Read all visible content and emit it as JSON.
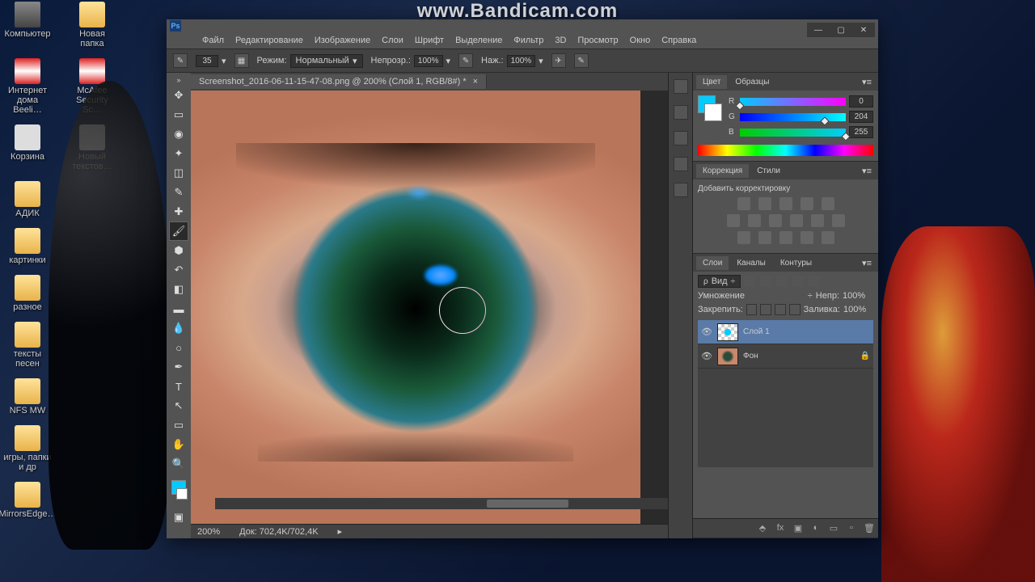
{
  "watermark": "www.Bandicam.com",
  "desktop": {
    "icons": [
      {
        "label": "Компьютер",
        "cls": "computer"
      },
      {
        "label": "Новая папка",
        "cls": "folder"
      },
      {
        "label": "Интернет дома Beeli…",
        "cls": "shield"
      },
      {
        "label": "McAfee Security Sc…",
        "cls": "shield"
      },
      {
        "label": "Корзина",
        "cls": "bin"
      },
      {
        "label": "Новый текстов…",
        "cls": "doc"
      },
      {
        "label": "АДИК",
        "cls": "folder"
      },
      {
        "label": "картинки",
        "cls": "folder"
      },
      {
        "label": "разное",
        "cls": "folder"
      },
      {
        "label": "тексты песен",
        "cls": "folder"
      },
      {
        "label": "NFS MW",
        "cls": "folder"
      },
      {
        "label": "игры, папки и др",
        "cls": "folder"
      },
      {
        "label": "MirrorsEdge…",
        "cls": "folder"
      }
    ]
  },
  "menu": [
    "Файл",
    "Редактирование",
    "Изображение",
    "Слои",
    "Шрифт",
    "Выделение",
    "Фильтр",
    "3D",
    "Просмотр",
    "Окно",
    "Справка"
  ],
  "options": {
    "brush_size": "35",
    "mode_label": "Режим:",
    "mode_value": "Нормальный",
    "opacity_label": "Непрозр.:",
    "opacity_value": "100%",
    "flow_label": "Наж.:",
    "flow_value": "100%"
  },
  "doc_tab": "Screenshot_2016-06-11-15-47-08.png @ 200% (Слой 1, RGB/8#) *",
  "status": {
    "zoom": "200%",
    "doc": "Док: 702,4K/702,4K"
  },
  "panels": {
    "color": {
      "tabs": [
        "Цвет",
        "Образцы"
      ],
      "r": "0",
      "g": "204",
      "b": "255"
    },
    "adjust": {
      "tabs": [
        "Коррекция",
        "Стили"
      ],
      "heading": "Добавить корректировку"
    },
    "layers": {
      "tabs": [
        "Слои",
        "Каналы",
        "Контуры"
      ],
      "view_label": "Вид",
      "blend_mode": "Умножение",
      "opacity_label": "Непр:",
      "opacity_value": "100%",
      "lock_label": "Закрепить:",
      "fill_label": "Заливка:",
      "fill_value": "100%",
      "items": [
        {
          "name": "Слой 1",
          "selected": true,
          "thumb": "cyan",
          "locked": false
        },
        {
          "name": "Фон",
          "selected": false,
          "thumb": "eye",
          "locked": true
        }
      ]
    }
  }
}
